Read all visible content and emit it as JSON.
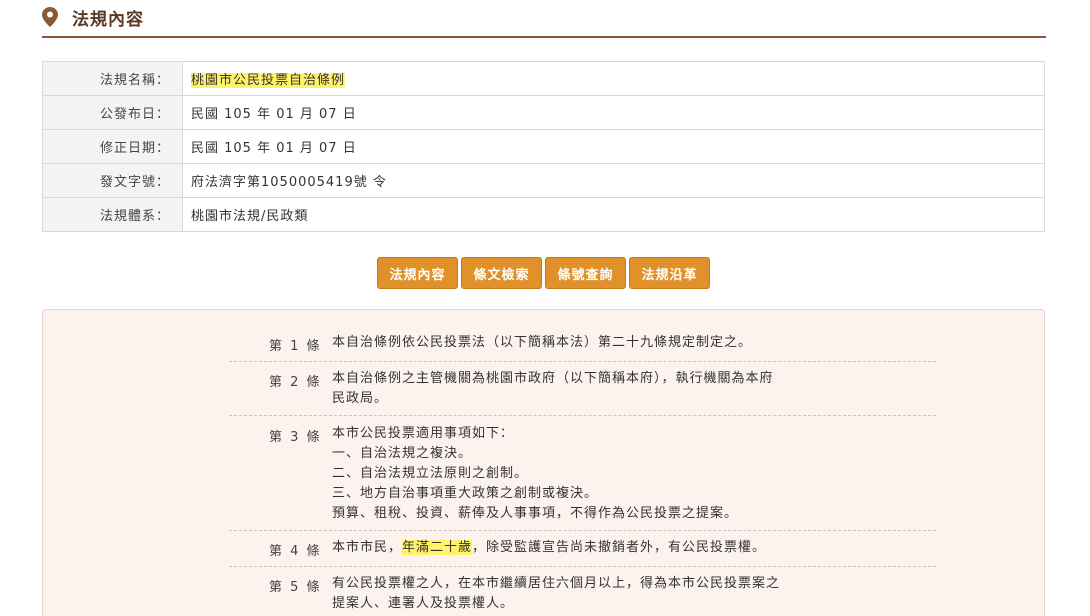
{
  "header": {
    "title": "法規內容",
    "icon": "map-pin-icon"
  },
  "info": [
    {
      "label": "法規名稱：",
      "value": "桃園市公民投票自治條例",
      "highlight": true
    },
    {
      "label": "公發布日：",
      "value": "民國 105 年 01 月 07 日"
    },
    {
      "label": "修正日期：",
      "value": "民國 105 年 01 月 07 日"
    },
    {
      "label": "發文字號：",
      "value": "府法濟字第1050005419號 令"
    },
    {
      "label": "法規體系：",
      "value": "桃園市法規/民政類"
    }
  ],
  "tabs": [
    "法規內容",
    "條文檢索",
    "條號查詢",
    "法規沿革"
  ],
  "articles": [
    {
      "num": "第 1 條",
      "lines": [
        "本自治條例依公民投票法（以下簡稱本法）第二十九條規定制定之。"
      ]
    },
    {
      "num": "第 2 條",
      "lines": [
        "本自治條例之主管機關為桃園市政府（以下簡稱本府），執行機關為本府",
        "民政局。"
      ]
    },
    {
      "num": "第 3 條",
      "lines": [
        "本市公民投票適用事項如下：",
        "一、自治法規之複決。",
        "二、自治法規立法原則之創制。",
        "三、地方自治事項重大政策之創制或複決。",
        "預算、租稅、投資、薪俸及人事事項，不得作為公民投票之提案。"
      ]
    },
    {
      "num": "第 4 條",
      "pre": "本市市民，",
      "highlight": "年滿二十歲",
      "post": "，除受監護宣告尚未撤銷者外，有公民投票權。"
    },
    {
      "num": "第 5 條",
      "lines": [
        "有公民投票權之人，在本市繼續居住六個月以上，得為本市公民投票案之",
        "提案人、連署人及投票權人。"
      ]
    }
  ],
  "colors": {
    "accent": "#e0912a",
    "header_line": "#8b5a34",
    "highlight": "#fff36b",
    "content_bg": "#fcf3ee"
  }
}
